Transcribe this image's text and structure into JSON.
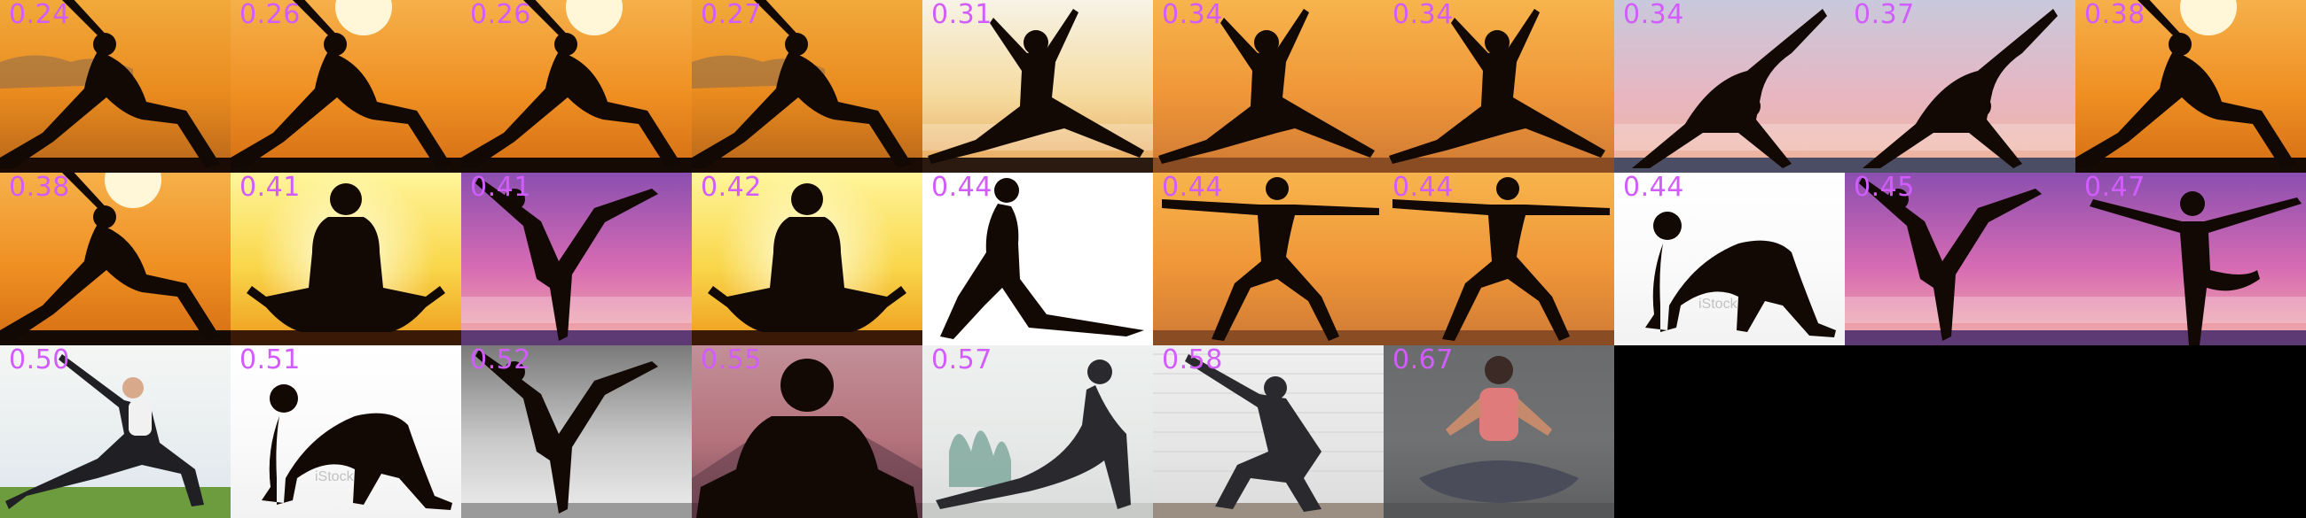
{
  "grid": {
    "rows": 3,
    "columns": 10,
    "cells": [
      {
        "score": "0.24",
        "scene": "sunset-orange-clouds",
        "pose": "crescent-lunge"
      },
      {
        "score": "0.26",
        "scene": "sunset-orange-sun",
        "pose": "crescent-lunge"
      },
      {
        "score": "0.26",
        "scene": "sunset-orange-sun",
        "pose": "crescent-lunge"
      },
      {
        "score": "0.27",
        "scene": "sunset-orange-clouds",
        "pose": "crescent-lunge"
      },
      {
        "score": "0.31",
        "scene": "sunset-pale-sea",
        "pose": "warrior"
      },
      {
        "score": "0.34",
        "scene": "sunset-orange-beach",
        "pose": "warrior"
      },
      {
        "score": "0.34",
        "scene": "sunset-orange-beach",
        "pose": "warrior"
      },
      {
        "score": "0.34",
        "scene": "sunset-pink-sea",
        "pose": "backbend-lunge"
      },
      {
        "score": "0.37",
        "scene": "sunset-pink-sea",
        "pose": "backbend-lunge"
      },
      {
        "score": "0.38",
        "scene": "sunset-orange-sun",
        "pose": "crescent-lunge"
      },
      {
        "score": "0.38",
        "scene": "sunset-orange-sun",
        "pose": "crescent-lunge"
      },
      {
        "score": "0.41",
        "scene": "sunset-yellow-glow",
        "pose": "lotus"
      },
      {
        "score": "0.41",
        "scene": "sunset-purple-sea",
        "pose": "dancer"
      },
      {
        "score": "0.42",
        "scene": "sunset-yellow-glow",
        "pose": "lotus"
      },
      {
        "score": "0.44",
        "scene": "white",
        "pose": "low-lunge"
      },
      {
        "score": "0.44",
        "scene": "sunset-orange-beach",
        "pose": "warrior-two"
      },
      {
        "score": "0.44",
        "scene": "sunset-orange-beach",
        "pose": "warrior-two"
      },
      {
        "score": "0.44",
        "scene": "white-stock",
        "pose": "cat"
      },
      {
        "score": "0.45",
        "scene": "sunset-purple-sea",
        "pose": "dancer"
      },
      {
        "score": "0.47",
        "scene": "sunset-purple-sea",
        "pose": "tree"
      },
      {
        "score": "0.50",
        "scene": "outdoor-grass",
        "pose": "crescent-lunge-photo"
      },
      {
        "score": "0.51",
        "scene": "white-stock",
        "pose": "cat"
      },
      {
        "score": "0.52",
        "scene": "grey-mist",
        "pose": "dancer"
      },
      {
        "score": "0.55",
        "scene": "dusk-mountains",
        "pose": "lotus-closeup"
      },
      {
        "score": "0.57",
        "scene": "studio-plants",
        "pose": "cobra-photo"
      },
      {
        "score": "0.58",
        "scene": "brick-wall",
        "pose": "chair"
      },
      {
        "score": "0.67",
        "scene": "grey-illustration",
        "pose": "lotus-illustration"
      },
      {
        "score": "",
        "scene": "empty",
        "pose": "none"
      },
      {
        "score": "",
        "scene": "empty",
        "pose": "none"
      },
      {
        "score": "",
        "scene": "empty",
        "pose": "none"
      }
    ],
    "watermark": "iStock"
  },
  "colors": {
    "score_text": "#d25cff",
    "background": "#000000"
  }
}
